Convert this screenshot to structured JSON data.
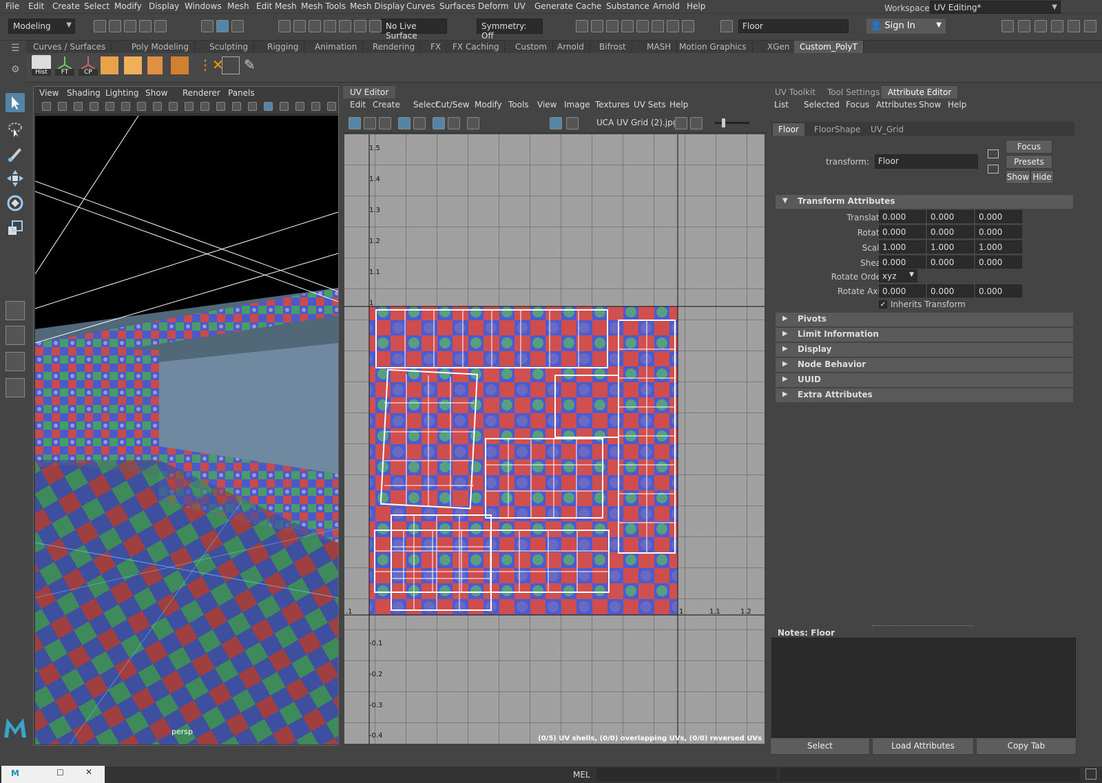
{
  "menu": [
    "File",
    "Edit",
    "Create",
    "Select",
    "Modify",
    "Display",
    "Windows",
    "Mesh",
    "Edit Mesh",
    "Mesh Tools",
    "Mesh Display",
    "Curves",
    "Surfaces",
    "Deform",
    "UV",
    "Generate",
    "Cache",
    "Substance",
    "Arnold",
    "Help"
  ],
  "workspace": {
    "label": "Workspace :",
    "value": "UV Editing*"
  },
  "toolbar": {
    "mode": "Modeling",
    "live_surface": "No Live Surface",
    "symmetry": "Symmetry: Off",
    "object_name": "Floor",
    "sign_in": "Sign In"
  },
  "shelf_tabs": [
    "Curves / Surfaces",
    "Poly Modeling",
    "Sculpting",
    "Rigging",
    "Animation",
    "Rendering",
    "FX",
    "FX Caching",
    "Custom",
    "Arnold",
    "Bifrost",
    "MASH",
    "Motion Graphics",
    "XGen",
    "Custom_PolyT"
  ],
  "shelf_active": "Custom_PolyT",
  "shelf_buttons": [
    "Hist",
    "FT",
    "CP"
  ],
  "viewport": {
    "menu": [
      "View",
      "Shading",
      "Lighting",
      "Show",
      "Renderer",
      "Panels"
    ],
    "camera": "persp"
  },
  "uv_editor": {
    "tab": "UV Editor",
    "menu": [
      "Edit",
      "Create",
      "Select",
      "Cut/Sew",
      "Modify",
      "Tools",
      "View",
      "Image",
      "Textures",
      "UV Sets",
      "Help"
    ],
    "texture": "UCA UV Grid (2).jpg",
    "v_ticks": [
      "1.5",
      "1.4",
      "1.3",
      "1.2",
      "1.1",
      "1",
      "-0.1",
      "-0.2",
      "-0.3",
      "-0.4"
    ],
    "u_ticks": [
      ".1",
      "1",
      "1.1",
      "1.2"
    ],
    "status": "(0/5) UV shells, (0/0) overlapping UVs, (0/0) reversed UVs"
  },
  "attr_editor": {
    "tabs": [
      "UV Toolkit",
      "Tool Settings",
      "Attribute Editor"
    ],
    "active_tab": "Attribute Editor",
    "menu": [
      "List",
      "Selected",
      "Focus",
      "Attributes",
      "Show",
      "Help"
    ],
    "node_tabs": [
      "Floor",
      "FloorShape",
      "UV_Grid"
    ],
    "transform_label": "transform:",
    "transform_value": "Floor",
    "buttons": {
      "focus": "Focus",
      "presets": "Presets",
      "show": "Show",
      "hide": "Hide"
    },
    "section_transform": "Transform Attributes",
    "rows": [
      {
        "label": "Translate",
        "values": [
          "0.000",
          "0.000",
          "0.000"
        ]
      },
      {
        "label": "Rotate",
        "values": [
          "0.000",
          "0.000",
          "0.000"
        ]
      },
      {
        "label": "Scale",
        "values": [
          "1.000",
          "1.000",
          "1.000"
        ]
      },
      {
        "label": "Shear",
        "values": [
          "0.000",
          "0.000",
          "0.000"
        ]
      }
    ],
    "rotate_order": {
      "label": "Rotate Order",
      "value": "xyz"
    },
    "rotate_axis": {
      "label": "Rotate Axis",
      "values": [
        "0.000",
        "0.000",
        "0.000"
      ]
    },
    "inherits": "Inherits Transform",
    "sections": [
      "Pivots",
      "Limit Information",
      "Display",
      "Node Behavior",
      "UUID",
      "Extra Attributes"
    ],
    "notes_label": "Notes:  Floor",
    "bottom_buttons": [
      "Select",
      "Load Attributes",
      "Copy Tab"
    ]
  },
  "status": {
    "mel": "MEL"
  },
  "colors": {
    "accent": "#5285a6",
    "bg": "#444444",
    "field": "#2b2b2b"
  }
}
